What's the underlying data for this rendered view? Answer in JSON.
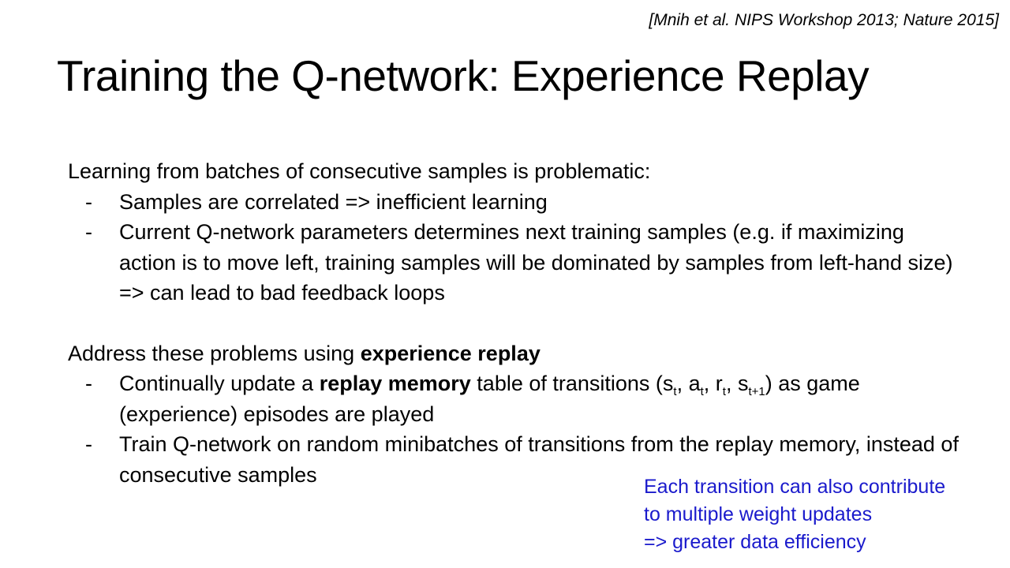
{
  "citation": "[Mnih et al. NIPS Workshop 2013; Nature 2015]",
  "title": "Training the Q-network: Experience Replay",
  "problems": {
    "intro": "Learning from batches of consecutive samples is problematic:",
    "bullets": [
      {
        "dash": "-",
        "text": "Samples are correlated => inefficient learning"
      },
      {
        "dash": "-",
        "text": "Current Q-network parameters determines next training samples (e.g. if maximizing action is to move left, training samples will be dominated by samples from left-hand size) => can lead to bad feedback loops"
      }
    ]
  },
  "solution": {
    "intro_prefix": "Address these problems using ",
    "intro_bold": "experience replay",
    "bullet1": {
      "dash": "-",
      "prefix": "Continually update a ",
      "bold": "replay memory",
      "mid": " table of transitions (s",
      "sub_t1": "t",
      "sep1": ", a",
      "sub_t2": "t",
      "sep2": ", r",
      "sub_t3": "t",
      "sep3": ", s",
      "sub_t4": "t+1",
      "suffix": ") as game (experience) episodes are played"
    },
    "bullet2": {
      "dash": "-",
      "text": "Train Q-network on random minibatches of transitions from the replay memory, instead of consecutive samples"
    }
  },
  "note": {
    "lines": [
      "Each transition can also contribute",
      "to multiple weight updates",
      "=> greater data efficiency"
    ],
    "color": "#1a1acc"
  }
}
